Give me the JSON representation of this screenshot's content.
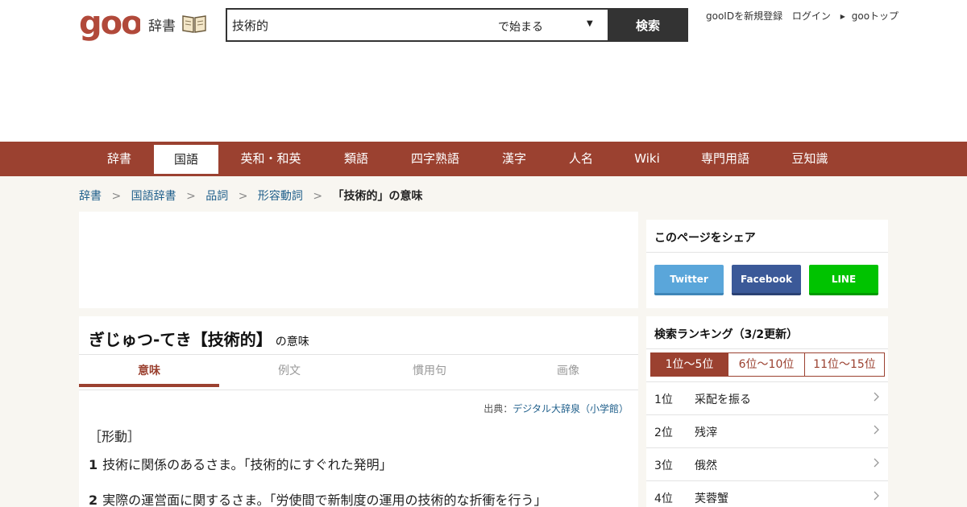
{
  "header": {
    "logo_text": "goo",
    "logo_sub": "辞書",
    "search": {
      "value": "技術的",
      "mode": "で始まる",
      "button": "検索"
    },
    "links": {
      "register": "gooIDを新規登録",
      "login": "ログイン",
      "top": "gooトップ"
    }
  },
  "nav": {
    "items": [
      "辞書",
      "国語",
      "英和・和英",
      "類語",
      "四字熟語",
      "漢字",
      "人名",
      "Wiki",
      "専門用語",
      "豆知識"
    ],
    "active": "国語"
  },
  "breadcrumb": {
    "items": [
      "辞書",
      "国語辞書",
      "品詞",
      "形容動詞"
    ],
    "separator": ">",
    "current": "「技術的」の意味"
  },
  "entry": {
    "title": "ぎじゅつ‐てき【技術的】",
    "title_suffix": "の意味",
    "tabs": [
      "意味",
      "例文",
      "慣用句",
      "画像"
    ],
    "active_tab": "意味",
    "source_label": "出典：",
    "source": "デジタル大辞泉（小学館）",
    "pos": "［形動］",
    "definitions": [
      {
        "num": "1",
        "text": "技術に関係のあるさま。「技術的にすぐれた発明」"
      },
      {
        "num": "2",
        "text": "実際の運営面に関するさま。「労使間で新制度の運用の技術的な折衝を行う」"
      }
    ]
  },
  "share": {
    "title": "このページをシェア",
    "twitter": "Twitter",
    "facebook": "Facebook",
    "line": "LINE"
  },
  "ranking": {
    "title": "検索ランキング（3/2更新）",
    "tabs": [
      "1位～5位",
      "6位～10位",
      "11位～15位"
    ],
    "active_tab": "1位～5位",
    "items": [
      {
        "rank": "1位",
        "word": "采配を振る"
      },
      {
        "rank": "2位",
        "word": "残滓"
      },
      {
        "rank": "3位",
        "word": "俄然"
      },
      {
        "rank": "4位",
        "word": "芙蓉蟹"
      }
    ]
  },
  "colors": {
    "brand": "#9b4130",
    "logo": "#b1493a",
    "link": "#1f5f8b"
  }
}
